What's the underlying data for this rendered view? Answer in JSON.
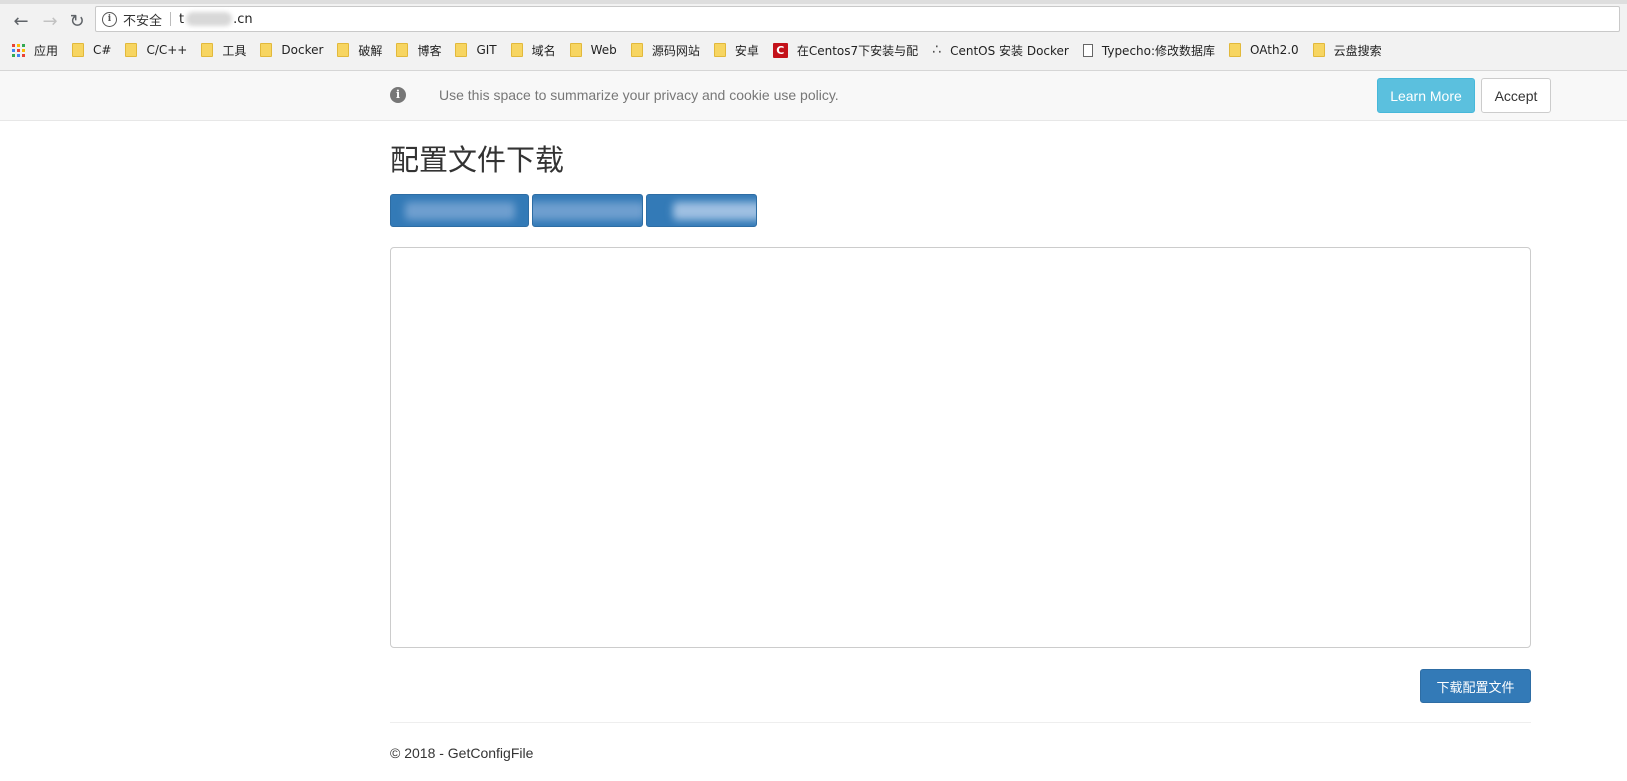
{
  "browser": {
    "address": {
      "security_label": "不安全",
      "url_prefix": "t",
      "url_suffix": ".cn"
    },
    "bookmarks": [
      {
        "icon": "apps-icon",
        "label": "应用"
      },
      {
        "icon": "folder-icon",
        "label": "C#"
      },
      {
        "icon": "folder-icon",
        "label": "C/C++"
      },
      {
        "icon": "folder-icon",
        "label": "工具"
      },
      {
        "icon": "folder-icon",
        "label": "Docker"
      },
      {
        "icon": "folder-icon",
        "label": "破解"
      },
      {
        "icon": "folder-icon",
        "label": "博客"
      },
      {
        "icon": "folder-icon",
        "label": "GIT"
      },
      {
        "icon": "folder-icon",
        "label": "域名"
      },
      {
        "icon": "folder-icon",
        "label": "Web"
      },
      {
        "icon": "folder-icon",
        "label": "源码网站"
      },
      {
        "icon": "folder-icon",
        "label": "安卓"
      },
      {
        "icon": "csdn-icon",
        "label": "在Centos7下安装与配"
      },
      {
        "icon": "centos-icon",
        "label": "CentOS 安装 Docker"
      },
      {
        "icon": "page-icon",
        "label": "Typecho:修改数据库"
      },
      {
        "icon": "folder-icon",
        "label": "OAth2.0"
      },
      {
        "icon": "folder-icon",
        "label": "云盘搜索"
      }
    ]
  },
  "cookie_banner": {
    "message": "Use this space to summarize your privacy and cookie use policy.",
    "learn_more_label": "Learn More",
    "accept_label": "Accept"
  },
  "main": {
    "title": "配置文件下载",
    "textarea_value": "",
    "download_label": "下载配置文件"
  },
  "footer": {
    "text": "© 2018 - GetConfigFile"
  },
  "colors": {
    "primary": "#337ab7",
    "info": "#5bc0de"
  }
}
